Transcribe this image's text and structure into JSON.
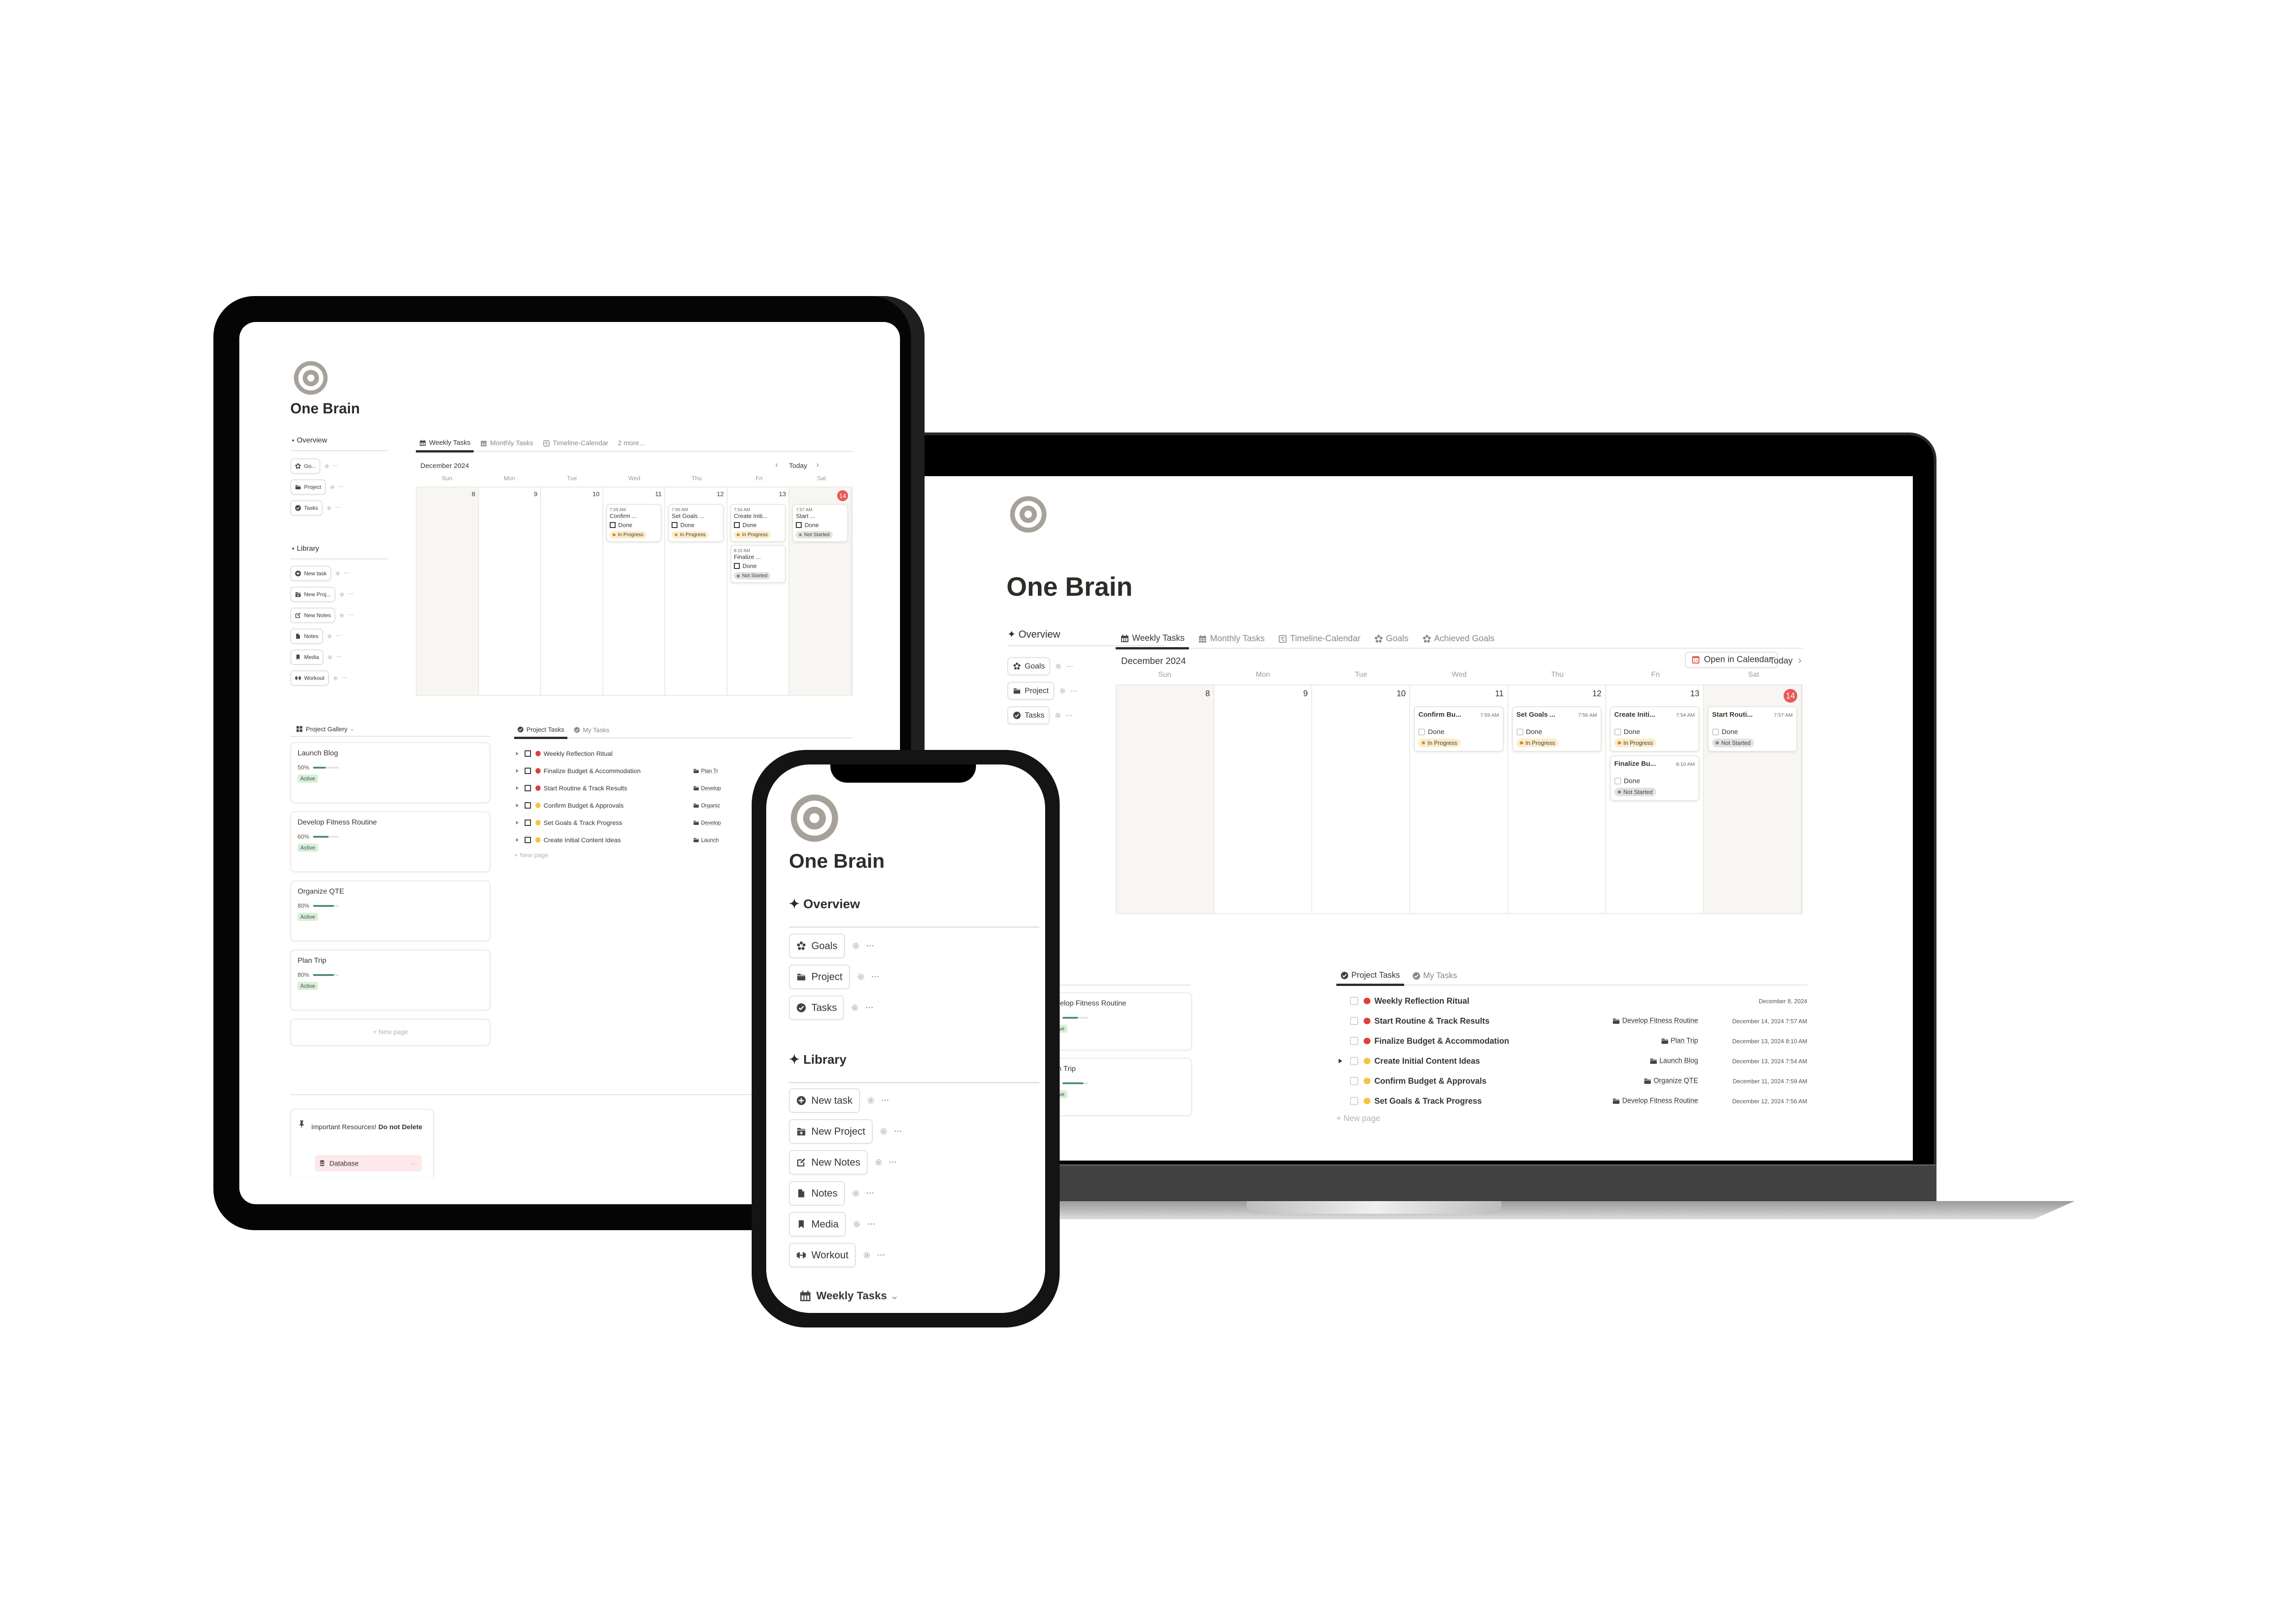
{
  "app": {
    "page_title": "One Brain",
    "page_icon": "target-icon"
  },
  "sidebar": {
    "overview_heading": "Overview",
    "overview_items": [
      {
        "label": "Goals",
        "short_label": "Go...",
        "icon": "goals-icon"
      },
      {
        "label": "Project",
        "icon": "folder-icon"
      },
      {
        "label": "Tasks",
        "icon": "check-circle-icon"
      }
    ],
    "library_heading": "Library",
    "library_items": [
      {
        "label": "New task",
        "icon": "plus-circle-icon"
      },
      {
        "label": "New Project",
        "short_label": "New Proj...",
        "icon": "folder-plus-icon"
      },
      {
        "label": "New Notes",
        "icon": "edit-icon"
      },
      {
        "label": "Notes",
        "icon": "document-icon"
      },
      {
        "label": "Media",
        "icon": "bookmark-icon"
      },
      {
        "label": "Workout",
        "icon": "dumbbell-icon"
      }
    ]
  },
  "calendar_view": {
    "tabs_tablet": [
      "Weekly Tasks",
      "Monthly Tasks",
      "Timeline-Calendar",
      "2 more..."
    ],
    "tabs_laptop": [
      "Weekly Tasks",
      "Monthly Tasks",
      "Timeline-Calendar",
      "Goals",
      "Achieved Goals"
    ],
    "active_tab": "Weekly Tasks",
    "month_label": "December 2024",
    "open_in_calendar": "Open in Calendar",
    "open_in_calendar_icon_day": "14",
    "today_label": "Today",
    "weekdays": [
      "Sun",
      "Mon",
      "Tue",
      "Wed",
      "Thu",
      "Fri",
      "Sat"
    ],
    "days": [
      "8",
      "9",
      "10",
      "11",
      "12",
      "13",
      "14"
    ],
    "today": "14",
    "done_label": "Done",
    "events": [
      {
        "day_index": 3,
        "time": "7:59 AM",
        "title_tablet": "Confirm ...",
        "title_laptop": "Confirm Bu...",
        "status": "In Progress",
        "status_kind": "prog"
      },
      {
        "day_index": 4,
        "time": "7:56 AM",
        "title_tablet": "Set Goals ...",
        "title_laptop": "Set Goals ...",
        "status": "In Progress",
        "status_kind": "prog"
      },
      {
        "day_index": 5,
        "time": "7:54 AM",
        "title_tablet": "Create Initi...",
        "title_laptop": "Create Initi...",
        "status": "In Progress",
        "status_kind": "prog"
      },
      {
        "day_index": 5,
        "time": "8:10 AM",
        "title_tablet": "Finalize ...",
        "title_laptop": "Finalize Bu...",
        "status": "Not Started",
        "status_kind": "ns"
      },
      {
        "day_index": 6,
        "time": "7:57 AM",
        "title_tablet": "Start ...",
        "title_laptop": "Start Routi...",
        "status": "Not Started",
        "status_kind": "ns"
      }
    ]
  },
  "project_gallery": {
    "heading": "Project Gallery",
    "cards": [
      {
        "title": "Launch Blog",
        "progress_percent": 50,
        "progress_label": "50%",
        "status": "Active"
      },
      {
        "title": "Develop Fitness Routine",
        "progress_percent": 60,
        "progress_label": "60%",
        "status": "Active"
      },
      {
        "title": "Organize QTE",
        "progress_percent": 80,
        "progress_label": "80%",
        "status": "Active"
      },
      {
        "title": "Plan Trip",
        "progress_percent": 80,
        "progress_label": "80%",
        "status": "Active"
      }
    ],
    "new_page_label": "New page",
    "laptop_gallery_fragment": "llery"
  },
  "tasks_view": {
    "tabs": [
      "Project Tasks",
      "My Tasks"
    ],
    "active_tab": "Project Tasks",
    "tablet_rows": [
      {
        "title": "Weekly Reflection Ritual",
        "priority": "high",
        "project": ""
      },
      {
        "title": "Finalize Budget & Accommodation",
        "priority": "high",
        "project": "Plan Tr"
      },
      {
        "title": "Start Routine & Track Results",
        "priority": "high",
        "project": "Develop"
      },
      {
        "title": "Confirm Budget & Approvals",
        "priority": "medium",
        "project": "Organiz"
      },
      {
        "title": "Set Goals & Track Progress",
        "priority": "medium",
        "project": "Develop"
      },
      {
        "title": "Create Initial Content Ideas",
        "priority": "medium",
        "project": "Launch"
      }
    ],
    "laptop_rows": [
      {
        "title": "Weekly Reflection Ritual",
        "priority": "high",
        "project": "",
        "date": "December 8, 2024",
        "has_subitems": false
      },
      {
        "title": "Start Routine & Track Results",
        "priority": "high",
        "project": "Develop Fitness Routine",
        "date": "December 14, 2024 7:57 AM",
        "has_subitems": false
      },
      {
        "title": "Finalize Budget & Accommodation",
        "priority": "high",
        "project": "Plan Trip",
        "date": "December 13, 2024 8:10 AM",
        "has_subitems": false
      },
      {
        "title": "Create Initial Content Ideas",
        "priority": "medium",
        "project": "Launch Blog",
        "date": "December 13, 2024 7:54 AM",
        "has_subitems": true
      },
      {
        "title": "Confirm Budget & Approvals",
        "priority": "medium",
        "project": "Organize QTE",
        "date": "December 11, 2024 7:59 AM",
        "has_subitems": false
      },
      {
        "title": "Set Goals & Track Progress",
        "priority": "medium",
        "project": "Develop Fitness Routine",
        "date": "December 12, 2024 7:56 AM",
        "has_subitems": false
      }
    ],
    "new_page_label": "New page"
  },
  "resources": {
    "heading": "Important Resources! Do not Delete",
    "heading_plain": "Important Resources! ",
    "heading_bold": "Do not Delete",
    "item_label": "Database"
  },
  "phone": {
    "bottom_view_label": "Weekly Tasks"
  },
  "colors": {
    "priority_high": "#e03e3e",
    "priority_medium": "#f5c344",
    "today_badge": "#eb5757",
    "in_progress_bg": "#fdecc8",
    "not_started_bg": "#e3e2e0",
    "active_tag_bg": "#dbeddb",
    "progress_fill": "#4f8d6a",
    "icon_gray": "#a6a29a"
  }
}
